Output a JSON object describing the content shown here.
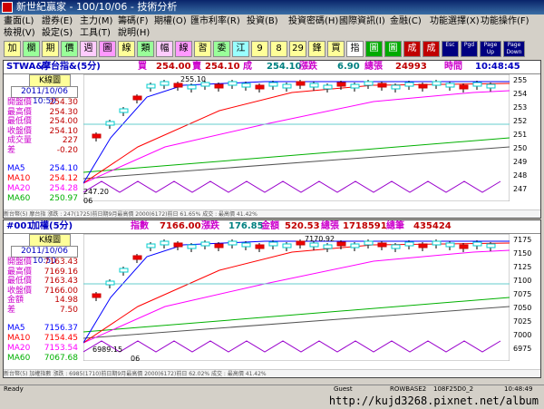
{
  "window": {
    "title": "新世紀贏家 - 100/10/06 - 技術分析"
  },
  "menu": {
    "row1": [
      "畫面(L)",
      "證券(E)",
      "主力(M)",
      "籌碼(F)",
      "期權(O)",
      "匯市利率(R)",
      "投資(B)",
      "投資密碼(H)",
      "國際資訊(I)",
      "金融(C)",
      "功能選擇(X)",
      "功能操作(F)"
    ],
    "row2": [
      "檢視(V)",
      "設定(S)",
      "工具(T)",
      "說明(H)"
    ]
  },
  "toolbar": {
    "buttons": [
      "加",
      "欄",
      "期",
      "價",
      "週",
      "圖",
      "線",
      "類",
      "幅",
      "線",
      "習",
      "委",
      "江",
      "9",
      "8",
      "29",
      "鋒",
      "買",
      "指",
      "圖",
      "圖",
      "成",
      "成",
      "Esc",
      "Pgd",
      "Page Up",
      "Page Down"
    ]
  },
  "panel1": {
    "header": {
      "symbol": "STWA&",
      "name": "摩台指&(5分)",
      "buy_label": "買",
      "buy": "254.00",
      "sell_label": "賣",
      "sell": "254.10",
      "deal_label": "成",
      "deal": "254.10",
      "change_label": "漲跌",
      "change": "6.90",
      "volume_label": "總張",
      "volume": "24993",
      "time_label": "時間",
      "time": "10:48:45"
    },
    "kline_label": "K線圖",
    "date": "2011/10/06 10:50",
    "info": [
      {
        "k": "開盤價",
        "v": "254.30"
      },
      {
        "k": "最高價",
        "v": "254.30"
      },
      {
        "k": "最低價",
        "v": "254.00"
      },
      {
        "k": "收盤價",
        "v": "254.10"
      },
      {
        "k": "成交量",
        "v": "227"
      },
      {
        "k": "差",
        "v": "-0.20"
      }
    ],
    "ma": [
      {
        "k": "MA5",
        "v": "254.10",
        "color": "#0000ff"
      },
      {
        "k": "MA10",
        "v": "254.12",
        "color": "#ff0000"
      },
      {
        "k": "MA20",
        "v": "254.28",
        "color": "#ff00ff"
      },
      {
        "k": "MA60",
        "v": "250.97",
        "color": "#00b000"
      }
    ],
    "high_label": "255.10",
    "low_label": "247.20",
    "x_label": "06",
    "yticks": [
      "255",
      "254",
      "253",
      "252",
      "251",
      "250",
      "249",
      "248",
      "247"
    ],
    "footer": "新台幣(5) 摩台指 漲跌 : 247(1725)前日期9月最高價 2000(6172)前日 61.65% 成交 : 最高價 41.42%"
  },
  "panel2": {
    "header": {
      "symbol": "#001",
      "name": "加權(5分)",
      "idx_label": "指數",
      "idx": "7166.00",
      "change_label": "漲跌",
      "change": "176.85",
      "amount_label": "金額",
      "amount": "520.53",
      "vol_label": "總張",
      "vol": "1718591",
      "total_label": "總筆",
      "total": "435424"
    },
    "kline_label": "K線圖",
    "date": "2011/10/06 10:50",
    "info": [
      {
        "k": "開盤價",
        "v": "7163.43"
      },
      {
        "k": "最高價",
        "v": "7169.16"
      },
      {
        "k": "最低價",
        "v": "7163.43"
      },
      {
        "k": "收盤價",
        "v": "7166.00"
      },
      {
        "k": "金額",
        "v": "14.98"
      },
      {
        "k": "差",
        "v": "7.50"
      }
    ],
    "ma": [
      {
        "k": "MA5",
        "v": "7156.37",
        "color": "#0000ff"
      },
      {
        "k": "MA10",
        "v": "7154.45",
        "color": "#ff0000"
      },
      {
        "k": "MA20",
        "v": "7153.54",
        "color": "#ff00ff"
      },
      {
        "k": "MA60",
        "v": "7067.68",
        "color": "#00b000"
      }
    ],
    "high_label": "7170.92",
    "low_label": "6989.15",
    "x_label": "06",
    "yticks": [
      "7175",
      "7150",
      "7125",
      "7100",
      "7075",
      "7050",
      "7025",
      "7000",
      "6975"
    ],
    "footer": "新台幣(5) 加權指數 漲跌 : 6985(1710)前日期9月最高價 2000(6172)前日 62.02% 成交 : 最高價 41.42%"
  },
  "status": {
    "left": "Ready",
    "guest": "Guest",
    "mode": "ROWBASE2",
    "code": "108F25D0_2",
    "time": "10:48:49",
    "url": "http://kujd3268.pixnet.net/album"
  }
}
